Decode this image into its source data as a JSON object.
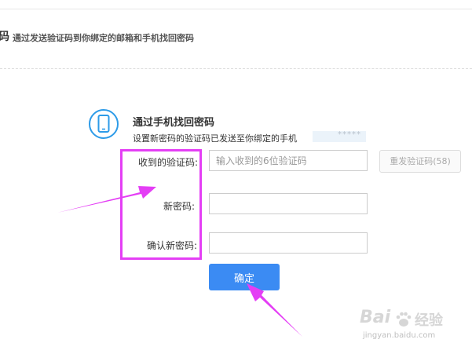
{
  "header": {
    "title_fragment": "码",
    "subtitle": "通过发送验证码到你绑定的邮箱和手机找回密码"
  },
  "method": {
    "title": "通过手机找回密码",
    "description": "设置新密码的验证码已发送至你绑定的手机",
    "masked_phone": "*****",
    "icon": "mobile-phone-icon"
  },
  "form": {
    "code": {
      "label": "收到的验证码:",
      "placeholder": "输入收到的6位验证码",
      "value": ""
    },
    "new_password": {
      "label": "新密码:",
      "value": ""
    },
    "confirm_password": {
      "label": "确认新密码:",
      "value": ""
    },
    "resend_label": "重发验证码(58)",
    "submit_label": "确定"
  },
  "watermark": {
    "logo": "Bai",
    "product": "经验",
    "url": "jingyan.baidu.com"
  },
  "colors": {
    "accent": "#3b8bf3",
    "annotation": "#e43ef5",
    "icon": "#2d9be8"
  }
}
